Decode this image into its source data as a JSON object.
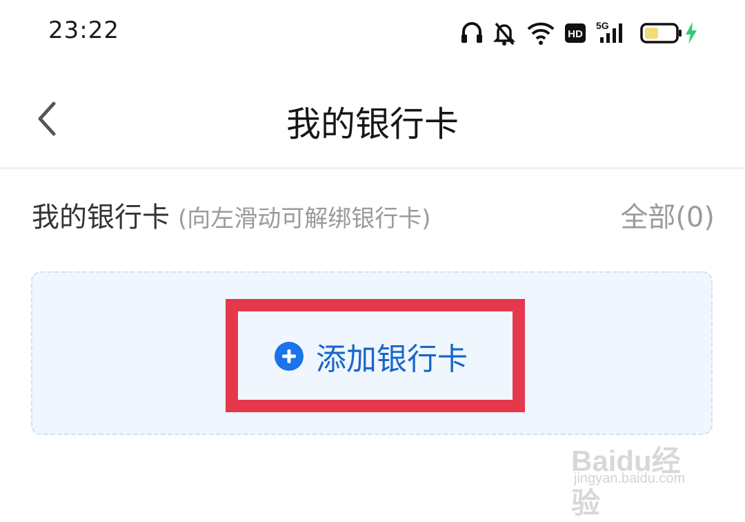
{
  "status_bar": {
    "time": "23:22",
    "icons": [
      "headset-icon",
      "bell-muted-icon",
      "wifi-icon",
      "hd-icon",
      "signal-5g-icon",
      "battery-icon",
      "charging-icon"
    ],
    "hd_label": "HD",
    "network_label": "5G",
    "battery_level": 0.4
  },
  "nav": {
    "title": "我的银行卡"
  },
  "section": {
    "title": "我的银行卡",
    "hint": "(向左滑动可解绑银行卡)",
    "count_label": "全部(0)"
  },
  "add_card": {
    "label": "添加银行卡"
  },
  "watermark": {
    "brand": "Baidu经验",
    "url": "jingyan.baidu.com"
  },
  "colors": {
    "accent": "#1a73e8",
    "highlight": "#e5384c",
    "card_bg": "#eff6fd"
  }
}
